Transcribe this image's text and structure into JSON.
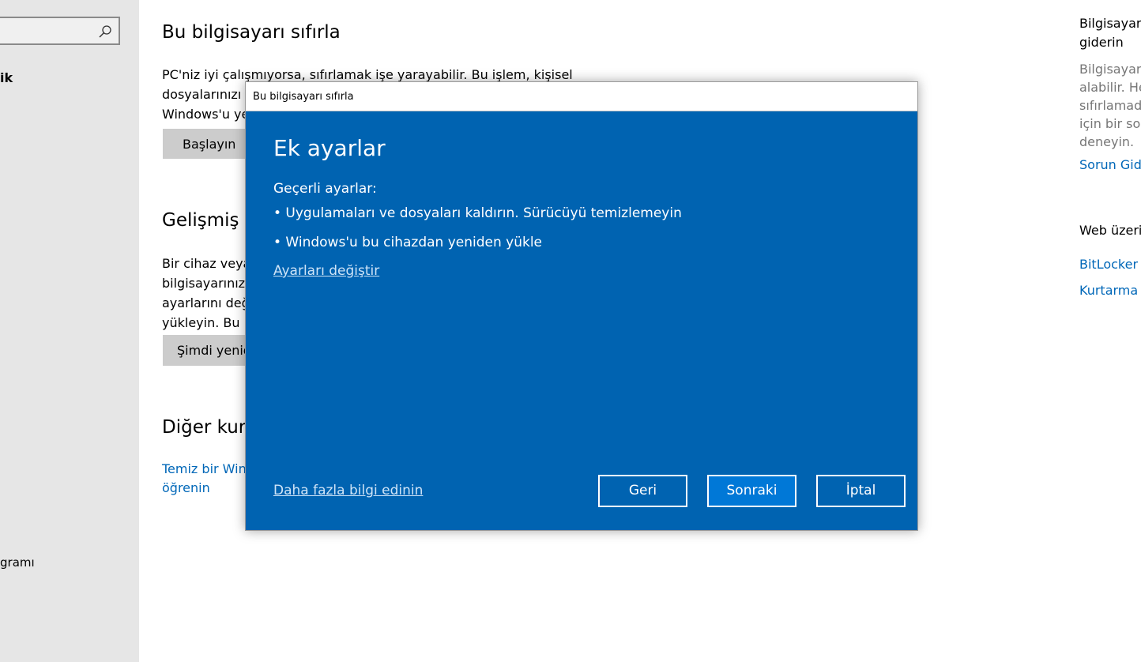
{
  "left_nav": {
    "item_top": "ik",
    "item_bottom": "gramı"
  },
  "main": {
    "reset": {
      "title": "Bu bilgisayarı sıfırla",
      "line1": "PC'niz iyi çalışmıyorsa, sıfırlamak işe yarayabilir. Bu işlem, kişisel",
      "line2": "dosyalarınızı k",
      "line3": "Windows'u ye",
      "button": "Başlayın"
    },
    "advanced": {
      "title": "Gelişmiş b",
      "line1": "Bir cihaz veya",
      "line2": "bilgisayarınızı",
      "line3": "ayarlarını değ",
      "line4": "yükleyin. Bu iş",
      "button": "Şimdi yenid"
    },
    "other": {
      "title": "Diğer kurt",
      "link_line1": "Temiz bir Win",
      "link_line2": "öğrenin"
    }
  },
  "right_col": {
    "title_line1": "Bilgisayarı",
    "title_line2": "giderin",
    "desc_line1": "Bilgisayarı",
    "desc_line2": "alabilir. He",
    "desc_line3": "sıfırlamada",
    "desc_line4": "için bir sor",
    "desc_line5": "deneyin.",
    "link_troubleshoot": "Sorun Gide",
    "web_heading": "Web üzeri",
    "link_bitlocker": "BitLocker I",
    "link_recovery": "Kurtarma s"
  },
  "dialog": {
    "window_title": "Bu bilgisayarı sıfırla",
    "heading": "Ek ayarlar",
    "current_label": "Geçerli ayarlar:",
    "settings": [
      "•  Uygulamaları ve dosyaları kaldırın. Sürücüyü temizlemeyin",
      "• Windows'u bu cihazdan yeniden yükle"
    ],
    "change_link": "Ayarları değiştir",
    "learn_more_link": "Daha fazla bilgi edinin",
    "back_label": "Geri",
    "next_label": "Sonraki",
    "cancel_label": "İptal"
  },
  "colors": {
    "dialog_bg": "#0063b1",
    "link_blue": "#0067b8",
    "primary_button": "#0078d7"
  },
  "icons": {
    "search": "search-icon"
  }
}
